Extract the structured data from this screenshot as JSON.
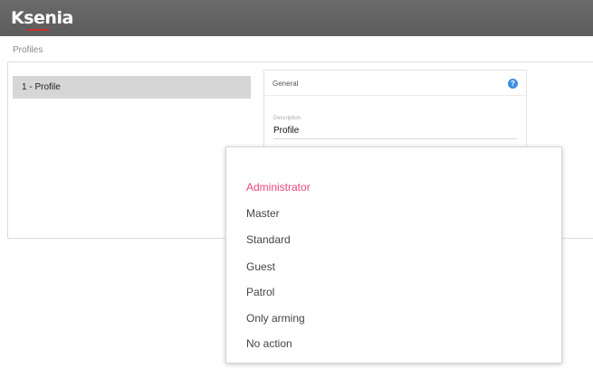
{
  "header": {
    "logo_prefix": "Ks",
    "logo_main": "enia"
  },
  "breadcrumb": "Profiles",
  "profiles_list": [
    {
      "label": "1 - Profile"
    }
  ],
  "detail": {
    "section_label": "General",
    "help_icon": "help-icon",
    "field_label": "Description",
    "field_value": "Profile"
  },
  "dropdown": {
    "selected": "Administrator",
    "options": [
      "Administrator",
      "Master",
      "Standard",
      "Guest",
      "Patrol",
      "Only arming",
      "No action"
    ]
  },
  "colors": {
    "topbar": "#5e5e5e",
    "accent_selected": "#e5467a",
    "logo_red": "#d9261c",
    "list_selected_bg": "#d6d6d6",
    "help_blue": "#3f8fe0"
  }
}
